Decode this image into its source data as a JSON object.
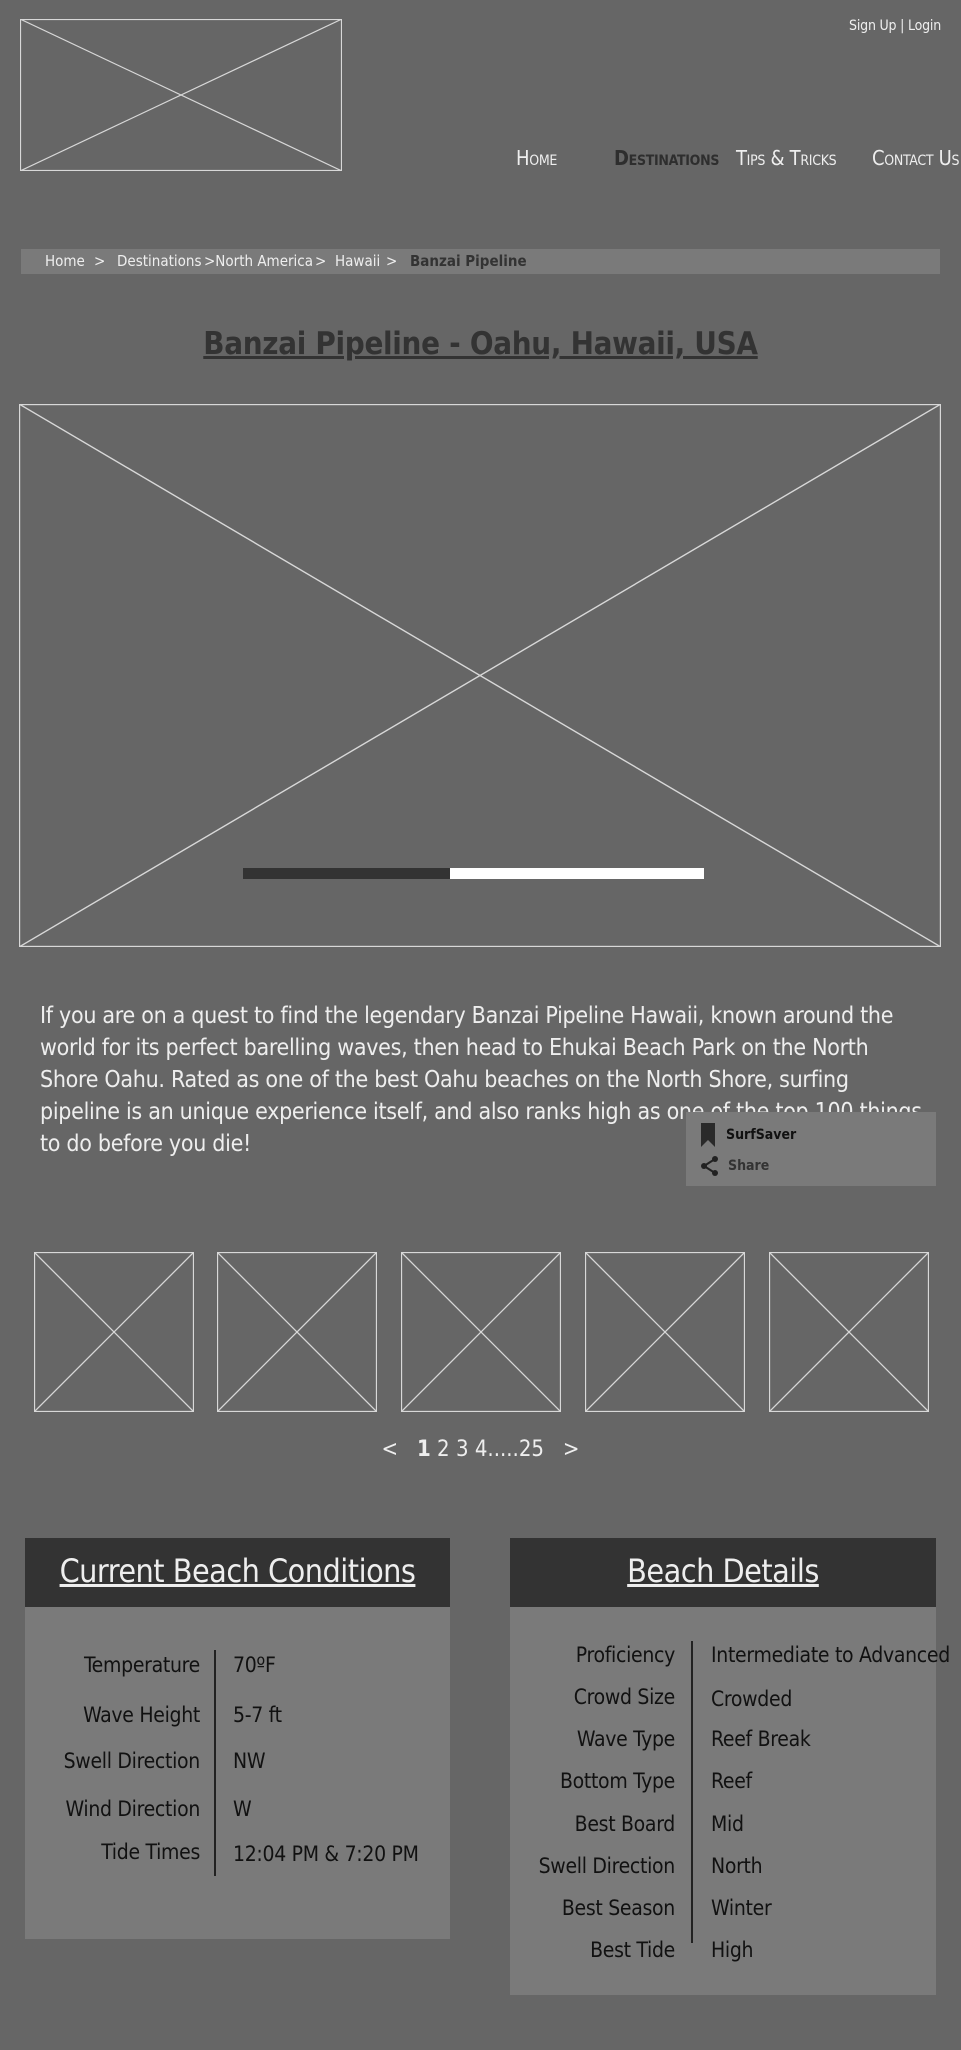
{
  "header": {
    "signup_label": "Sign Up",
    "separator": "|",
    "login_label": "Login",
    "nav": [
      "Home",
      "Destinations",
      "Tips & Tricks",
      "Contact Us"
    ],
    "active_nav": "Destinations"
  },
  "breadcrumb": {
    "items": [
      "Home",
      ">",
      "Destinations",
      ">North America",
      ">",
      "Hawaii",
      ">",
      "Banzai Pipeline"
    ]
  },
  "page_title": "Banzai Pipeline - Oahu, Hawaii, USA",
  "slideshow": {
    "progress": 0.45
  },
  "description": "If you are on a quest to find the legendary Banzai Pipeline Hawaii, known around the world  for its perfect barelling waves, then head to Ehukai Beach Park on the North Shore Oahu.  Rated as one of the best Oahu beaches on the North Shore, surfing pipeline is an unique experience itself, and also ranks high as one of the top 100 things to do before you die!",
  "actions": {
    "save_label": "SurfSaver",
    "save_icon": "bookmark-icon",
    "share_label": "Share",
    "share_icon": "share-icon"
  },
  "pagination": {
    "prev": "<",
    "current": "1",
    "pages": [
      "2",
      "3",
      "4"
    ],
    "ellipsis": ".....",
    "last": "25",
    "next": ">"
  },
  "conditions": {
    "title": "Current Beach Conditions",
    "labels": [
      "Temperature",
      "Wave Height",
      "Swell Direction",
      "Wind Direction",
      "Tide Times"
    ],
    "values": [
      "70ºF",
      "5-7 ft",
      "NW",
      "W",
      "12:04 PM & 7:20 PM"
    ]
  },
  "details": {
    "title": "Beach Details",
    "labels": [
      "Proficiency",
      "Crowd Size",
      "Wave Type",
      "Bottom Type",
      "Best Board",
      "Swell Direction",
      "Best Season",
      "Best Tide"
    ],
    "values": [
      "Intermediate to Advanced",
      "Crowded",
      "Reef Break",
      "Reef",
      "Mid",
      "North",
      "Winter",
      "High"
    ]
  },
  "colors": {
    "background": "#666666",
    "panel": "#7a7a7a",
    "panel_header": "#333333",
    "text_light": "#eeeeee",
    "text_dark": "#111111"
  }
}
